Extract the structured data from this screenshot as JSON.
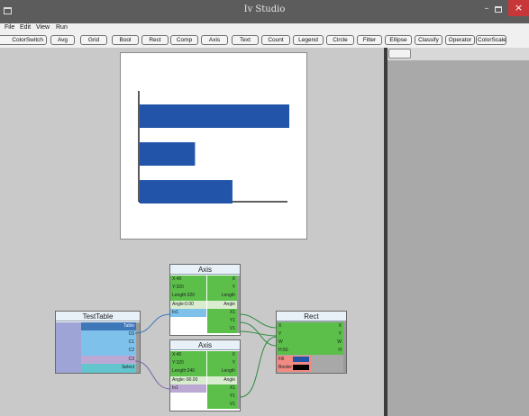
{
  "window": {
    "title": "Iv Studio",
    "minimize_glyph": "–",
    "close_glyph": "×",
    "icons": [
      "app-icon",
      "minimize-icon",
      "maximize-icon",
      "close-icon"
    ]
  },
  "menu": [
    "File",
    "Edit",
    "View",
    "Run"
  ],
  "toolbar": [
    "ColorSwitch",
    "Avg",
    "Grid",
    "Bool",
    "Rect",
    "Comp",
    "Axis",
    "Text",
    "Count",
    "Legend",
    "Circle",
    "Filter",
    "Ellipse",
    "Classify",
    "Operator",
    "ColorScale"
  ],
  "colors": {
    "bar": "#2255aa",
    "node_green": "#5bbf4a",
    "node_blue": "#7ec2ec",
    "node_purple": "#bca9d3",
    "node_teal": "#63c6ce",
    "wire_blue": "#3a78b8",
    "wire_green": "#2e8b3e",
    "wire_purple": "#7a62a8"
  },
  "chart_data": {
    "type": "bar",
    "orientation": "horizontal",
    "values": [
      100,
      37,
      62
    ],
    "xlim": [
      0,
      100
    ]
  },
  "nodes": {
    "axis1": {
      "title": "Axis",
      "fields": [
        "X:40",
        "Y:320",
        "Length:320",
        "Angle:0.00"
      ],
      "outputs": [
        "X",
        "Y",
        "Length",
        "Angle"
      ],
      "inputs": [
        "In1"
      ],
      "ports": [
        "X1",
        "Y1",
        "V1"
      ]
    },
    "axis2": {
      "title": "Axis",
      "fields": [
        "X:40",
        "Y:320",
        "Length:240",
        "Angle:-90.00"
      ],
      "outputs": [
        "X",
        "Y",
        "Length",
        "Angle"
      ],
      "inputs": [
        "In1"
      ],
      "ports": [
        "X1",
        "Y1",
        "V1"
      ]
    },
    "testtable": {
      "title": "TestTable",
      "rows": [
        "Table",
        "C0",
        "C1",
        "C2",
        "C3",
        "Select"
      ]
    },
    "rect": {
      "title": "Rect",
      "left": [
        "X",
        "Y",
        "W",
        "H:50"
      ],
      "right": [
        "X",
        "Y",
        "W",
        "H"
      ],
      "fill_label": "Fill",
      "border_label": "Border",
      "fill_color": "#2255aa",
      "border_color": "#000000"
    }
  }
}
